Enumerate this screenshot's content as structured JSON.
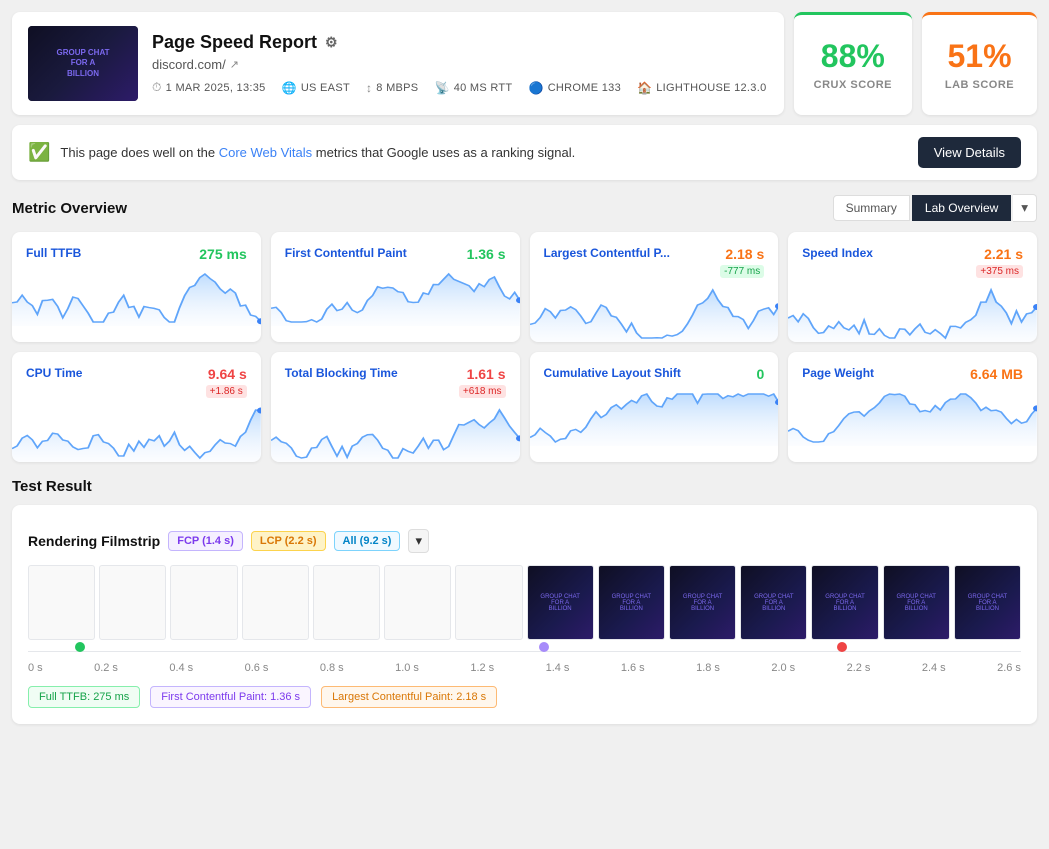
{
  "header": {
    "title": "Page Speed Report",
    "url": "discord.com/",
    "meta": [
      {
        "icon": "⏱",
        "text": "1 MAR 2025, 13:35"
      },
      {
        "icon": "🌐",
        "text": "US EAST"
      },
      {
        "icon": "↕",
        "text": "8 MBPS"
      },
      {
        "icon": "📡",
        "text": "40 MS RTT"
      },
      {
        "icon": "🔵",
        "text": "CHROME 133"
      },
      {
        "icon": "🏠",
        "text": "LIGHTHOUSE 12.3.0"
      }
    ]
  },
  "scores": {
    "crux": {
      "value": "88%",
      "label": "CRUX SCORE",
      "color": "green"
    },
    "lab": {
      "value": "51%",
      "label": "LAB SCORE",
      "color": "orange"
    }
  },
  "banner": {
    "text": "This page does well on the",
    "link": "Core Web Vitals",
    "suffix": " metrics that Google uses as a ranking signal.",
    "button": "View Details"
  },
  "metric_overview": {
    "title": "Metric Overview",
    "tabs": [
      "Summary",
      "Lab Overview"
    ],
    "active_tab": "Lab Overview"
  },
  "metrics": [
    {
      "name": "Full TTFB",
      "value": "275 ms",
      "color": "green",
      "delta": null
    },
    {
      "name": "First Contentful Paint",
      "value": "1.36 s",
      "color": "green",
      "delta": null
    },
    {
      "name": "Largest Contentful P...",
      "value": "2.18 s",
      "color": "orange",
      "delta": "-777 ms",
      "delta_color": "green-bg"
    },
    {
      "name": "Speed Index",
      "value": "2.21 s",
      "color": "orange",
      "delta": "+375 ms",
      "delta_color": "red-bg"
    },
    {
      "name": "CPU Time",
      "value": "9.64 s",
      "color": "red",
      "delta": "+1.86 s",
      "delta_color": "red-bg"
    },
    {
      "name": "Total Blocking Time",
      "value": "1.61 s",
      "color": "red",
      "delta": "+618 ms",
      "delta_color": "red-bg"
    },
    {
      "name": "Cumulative Layout Shift",
      "value": "0",
      "color": "green",
      "delta": null
    },
    {
      "name": "Page Weight",
      "value": "6.64 MB",
      "color": "orange",
      "delta": null
    }
  ],
  "test_result": {
    "title": "Test Result",
    "filmstrip_label": "Rendering Filmstrip",
    "badges": [
      {
        "label": "FCP (1.4 s)",
        "class": "fcp"
      },
      {
        "label": "LCP (2.2 s)",
        "class": "lcp"
      },
      {
        "label": "All (9.2 s)",
        "class": "all"
      }
    ],
    "timeline_labels": [
      "0 s",
      "0.2 s",
      "0.4 s",
      "0.6 s",
      "0.8 s",
      "1.0 s",
      "1.2 s",
      "1.4 s",
      "1.6 s",
      "1.8 s",
      "2.0 s",
      "2.2 s",
      "2.4 s",
      "2.6 s"
    ],
    "markers": [
      {
        "label": "Full TTFB: 275 ms",
        "class": "ttfb"
      },
      {
        "label": "First Contentful Paint: 1.36 s",
        "class": "fcp"
      },
      {
        "label": "Largest Contentful Paint: 2.18 s",
        "class": "lcp"
      }
    ]
  }
}
